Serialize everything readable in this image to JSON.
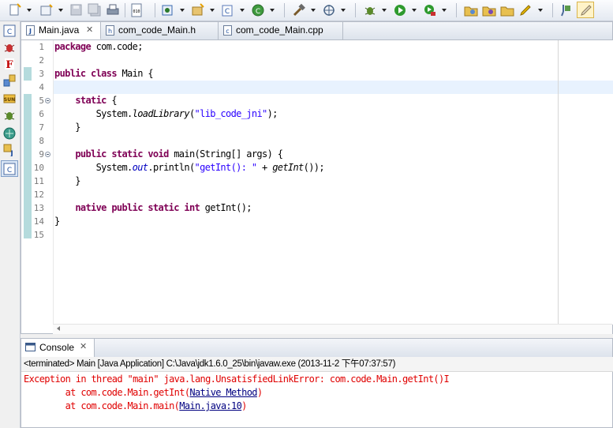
{
  "toolbar": {
    "buttons": [
      "new-icon",
      "new-wizard-icon",
      "save-icon",
      "save-all-icon",
      "print-icon",
      "binary-icon",
      "new-java-class-icon",
      "new-package-icon",
      "new-c-class-icon",
      "new-run-icon",
      "build-icon",
      "target-icon",
      "debug-icon",
      "run-icon",
      "run-external-icon",
      "open-type-icon",
      "open-project-icon",
      "open-folder-icon",
      "highlight-icon",
      "editor-pin-icon",
      "active-perspective-icon"
    ]
  },
  "sidebar": {
    "icons": [
      "cpp-perspective-icon",
      "debug-perspective-icon",
      "flash-icon",
      "java-ee-icon",
      "sun-icon",
      "bug-icon",
      "team-icon",
      "java-perspective-icon",
      "c-perspective-active-icon"
    ]
  },
  "editor": {
    "tabs": [
      {
        "label": "Main.java",
        "close": "✕",
        "active": true
      },
      {
        "label": "com_code_Main.h",
        "active": false
      },
      {
        "label": "com_code_Main.cpp",
        "active": false
      }
    ],
    "line_numbers": [
      "1",
      "2",
      "3",
      "4",
      "5",
      "6",
      "7",
      "8",
      "9",
      "10",
      "11",
      "12",
      "13",
      "14",
      "15"
    ],
    "code": {
      "l1_kw": "package",
      "l1_rest": " com.code;",
      "l3_kw": "public class",
      "l3_rest": " Main {",
      "l5_indent": "    ",
      "l5_kw": "static",
      "l5_rest": " {",
      "l6_indent": "        ",
      "l6_a": "System.",
      "l6_m": "loadLibrary",
      "l6_b": "(",
      "l6_s": "\"lib_code_jni\"",
      "l6_c": ");",
      "l7_text": "    }",
      "l9_indent": "    ",
      "l9_kw": "public static void",
      "l9_rest": " main(String[] args) {",
      "l10_indent": "        ",
      "l10_a": "System.",
      "l10_f": "out",
      "l10_b": ".println(",
      "l10_s": "\"getInt(): \"",
      "l10_c": " + ",
      "l10_m": "getInt",
      "l10_d": "());",
      "l11_text": "    }",
      "l13_indent": "    ",
      "l13_kw": "native public static int",
      "l13_rest": " getInt();",
      "l14_text": "}"
    }
  },
  "console": {
    "tab_label": "Console",
    "close": "✕",
    "status": "<terminated> Main [Java Application] C:\\Java\\jdk1.6.0_25\\bin\\javaw.exe (2013-11-2 下午07:37:57)",
    "line1": "Exception in thread \"main\" java.lang.UnsatisfiedLinkError: com.code.Main.getInt()I",
    "line2_pre": "        at com.code.Main.getInt(",
    "line2_link": "Native Method",
    "line2_post": ")",
    "line3_pre": "        at com.code.Main.main(",
    "line3_link": "Main.java:10",
    "line3_post": ")"
  }
}
